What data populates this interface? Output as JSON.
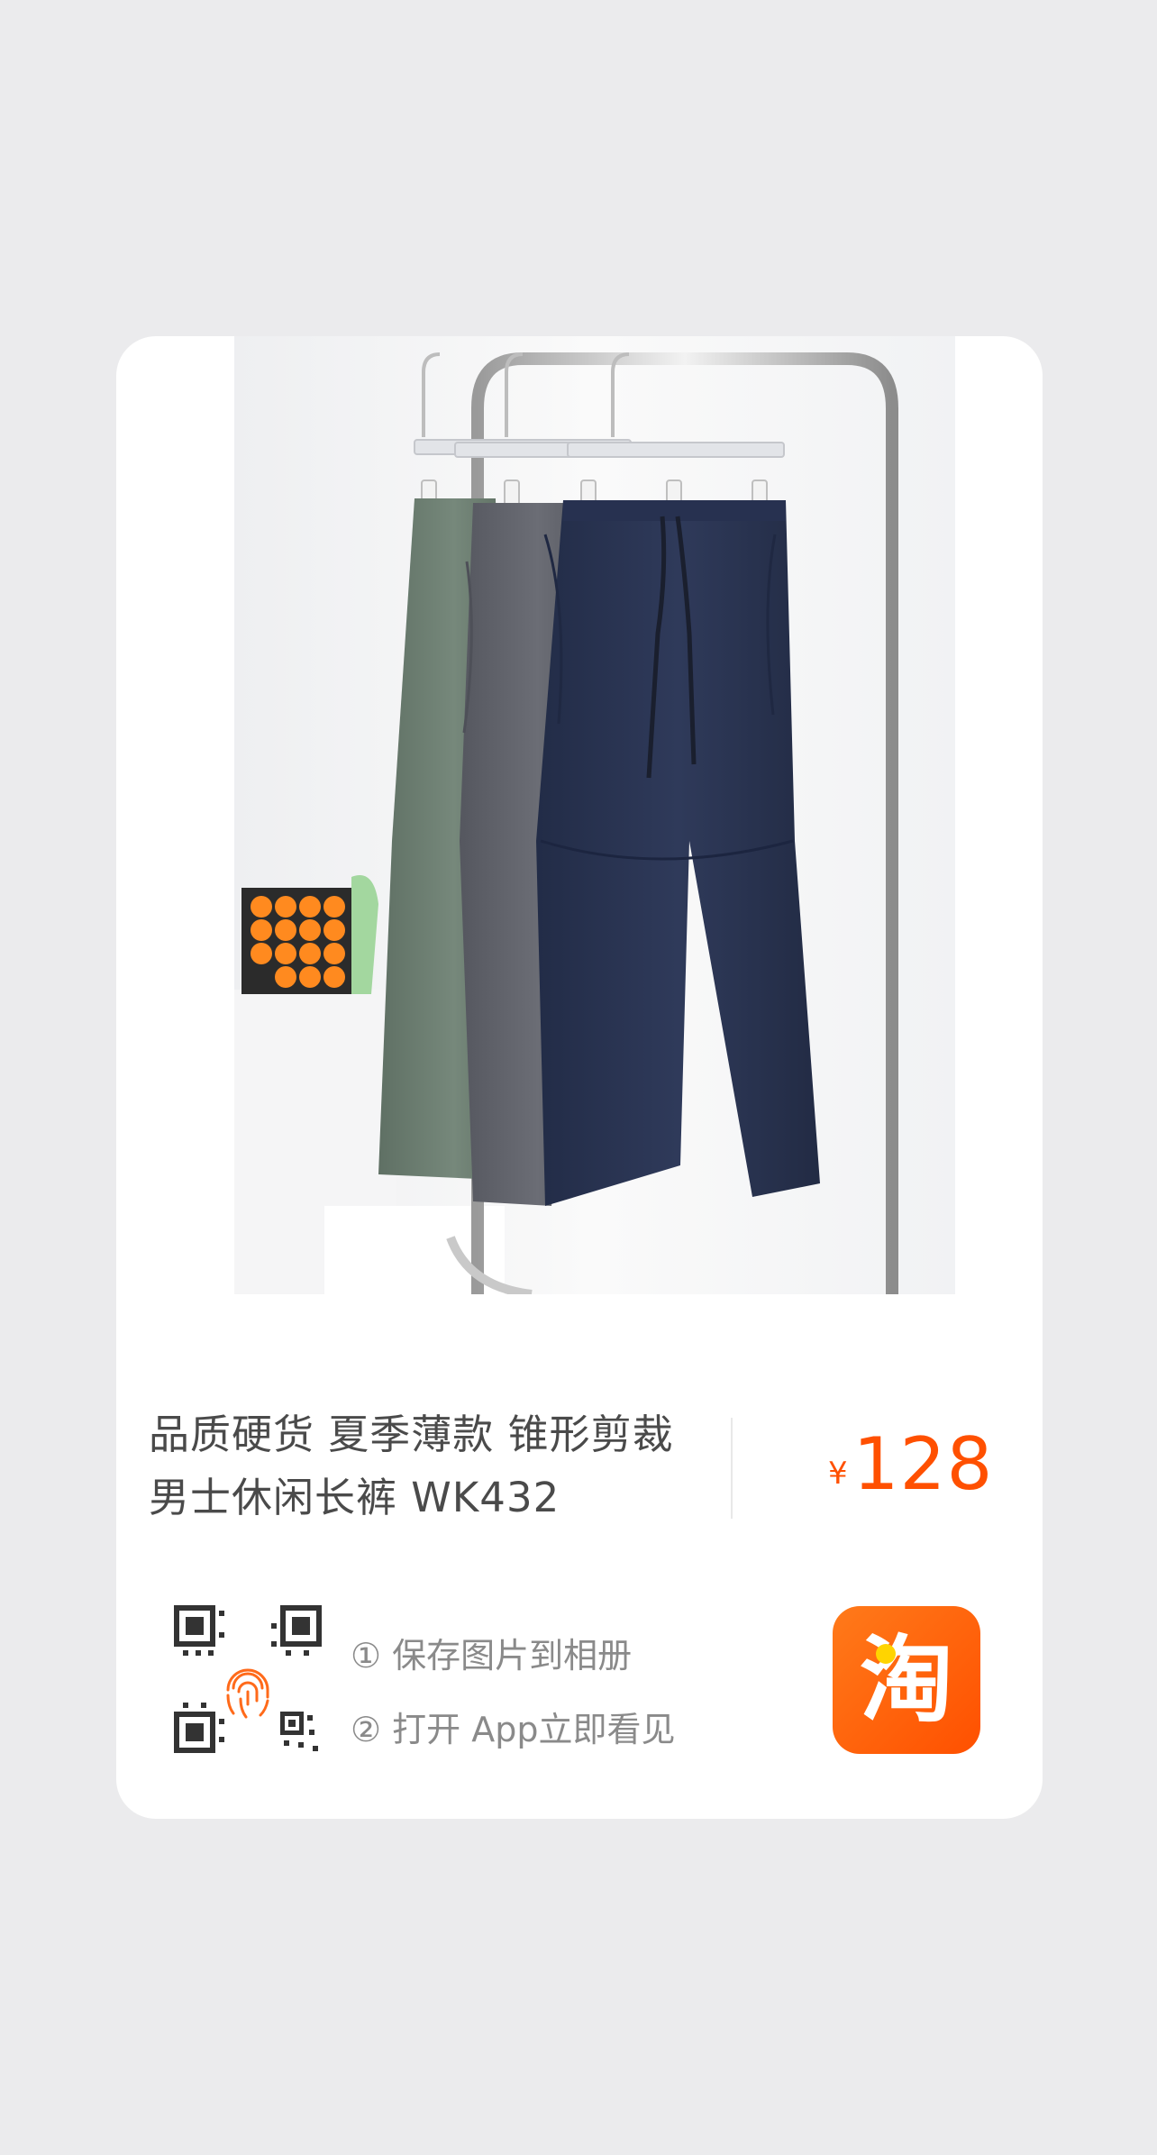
{
  "product": {
    "title": "品质硬货 夏季薄款 锥形剪裁 男士休闲长裤 WK432",
    "currency_symbol": "¥",
    "price": "128",
    "image": {
      "pants_colors": [
        "#6e7f73",
        "#62646c",
        "#2a3552"
      ],
      "hanger_count": 3
    }
  },
  "instructions": {
    "step1": "① 保存图片到相册",
    "step2": "② 打开 App立即看见"
  },
  "app": {
    "icon": "taobao-app-icon",
    "icon_glyph": "淘",
    "brand_color": "#ff5000"
  },
  "qr_icon": "qr-scan-fingerprint-icon",
  "colors": {
    "background": "#ebebed",
    "card": "#ffffff",
    "price": "#ff5000",
    "title": "#4a4a4a",
    "hint": "#8a8a8a"
  }
}
